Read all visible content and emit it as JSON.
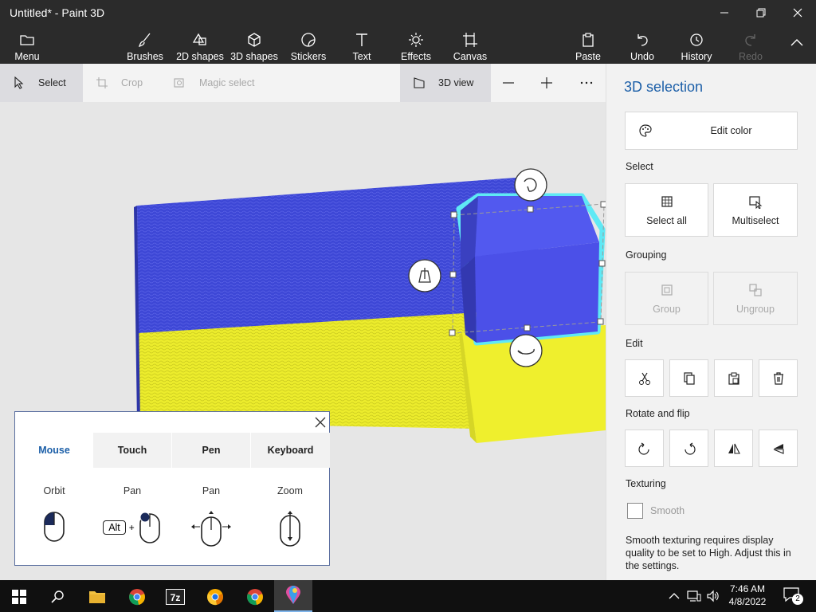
{
  "window": {
    "title": "Untitled* - Paint 3D"
  },
  "ribbon": {
    "menu": "Menu",
    "tools": [
      "Brushes",
      "2D shapes",
      "3D shapes",
      "Stickers",
      "Text",
      "Effects",
      "Canvas"
    ],
    "paste": "Paste",
    "undo": "Undo",
    "history": "History",
    "redo": "Redo"
  },
  "toolbar": {
    "select": "Select",
    "crop": "Crop",
    "magic_select": "Magic select",
    "view3d": "3D view"
  },
  "panel": {
    "title": "3D selection",
    "edit_color": "Edit color",
    "select_section": "Select",
    "select_all": "Select all",
    "multiselect": "Multiselect",
    "grouping_section": "Grouping",
    "group": "Group",
    "ungroup": "Ungroup",
    "edit_section": "Edit",
    "rotate_section": "Rotate and flip",
    "texturing_section": "Texturing",
    "smooth": "Smooth",
    "smooth_note": "Smooth texturing requires display quality to be set to High. Adjust this in the settings."
  },
  "help": {
    "tabs": [
      "Mouse",
      "Touch",
      "Pen",
      "Keyboard"
    ],
    "active_tab": "Mouse",
    "labels": [
      "Orbit",
      "Pan",
      "Pan",
      "Zoom"
    ],
    "alt_key": "Alt",
    "plus": "+"
  },
  "taskbar": {
    "time": "7:46 AM",
    "date": "4/8/2022",
    "notifications": "2"
  },
  "colors": {
    "accent": "#1c5fa8",
    "flag_blue": "#3d47d6",
    "flag_yellow": "#ecec2c",
    "cube_blue": "#4b50e8",
    "selection_glow": "#5fe9f5"
  }
}
